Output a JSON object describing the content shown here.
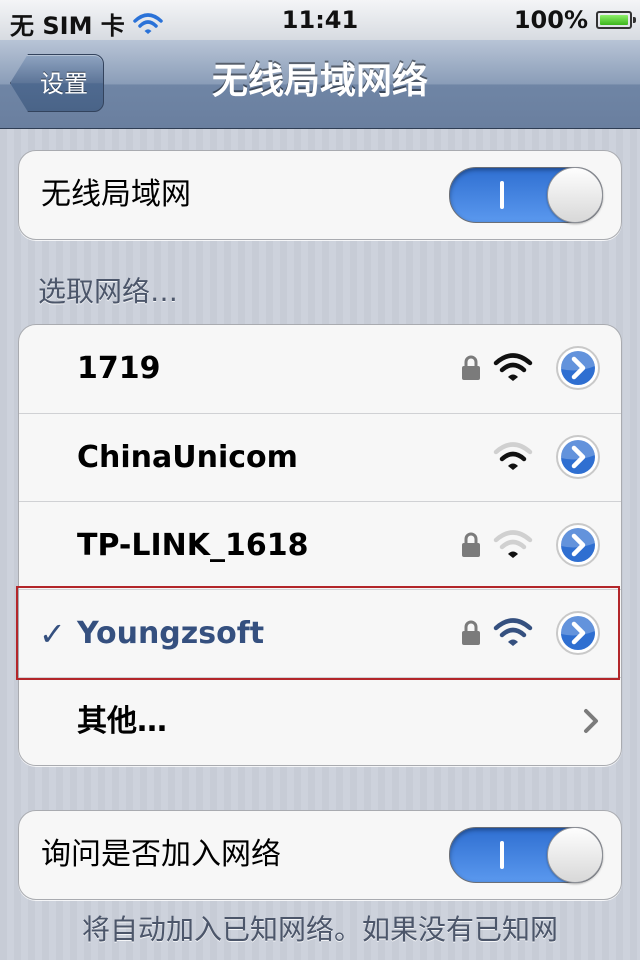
{
  "status_bar": {
    "carrier": "无 SIM 卡",
    "time": "11:41",
    "battery": "100%",
    "battery_level": 1.0
  },
  "nav": {
    "back_label": "设置",
    "title": "无线局域网络"
  },
  "wifi_toggle": {
    "label": "无线局域网",
    "on": true
  },
  "section_header": "选取网络…",
  "networks": [
    {
      "name": "1719",
      "locked": true,
      "signal": 3,
      "selected": false
    },
    {
      "name": "ChinaUnicom",
      "locked": false,
      "signal": 2,
      "selected": false
    },
    {
      "name": "TP-LINK_1618",
      "locked": true,
      "signal": 1,
      "selected": false
    },
    {
      "name": "Youngzsoft",
      "locked": true,
      "signal": 3,
      "selected": true
    }
  ],
  "selected_mark": "✓",
  "other_label": "其他…",
  "ask_toggle": {
    "label": "询问是否加入网络",
    "on": true
  },
  "footer_note": "将自动加入已知网络。如果没有已知网",
  "colors": {
    "accent": "#35507f",
    "toggle_blue": "#2f6fd1",
    "highlight_red": "#b3262a"
  }
}
